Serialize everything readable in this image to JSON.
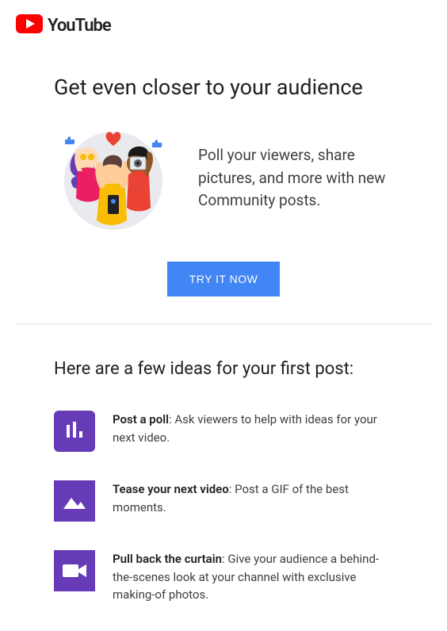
{
  "logo": {
    "text": "YouTube"
  },
  "heading": "Get even closer to your audience",
  "hero_text": "Poll your viewers, share pictures, and more with new Community posts.",
  "cta_label": "TRY IT NOW",
  "ideas_heading": "Here are a few ideas for your first post:",
  "ideas": [
    {
      "title": "Post a poll",
      "body": ": Ask viewers to help with ideas for your next video."
    },
    {
      "title": "Tease your next video",
      "body": ": Post a GIF of the best moments."
    },
    {
      "title": "Pull back the curtain",
      "body": ": Give your audience a behind-the-scenes look at your channel with exclusive making-of photos."
    }
  ]
}
